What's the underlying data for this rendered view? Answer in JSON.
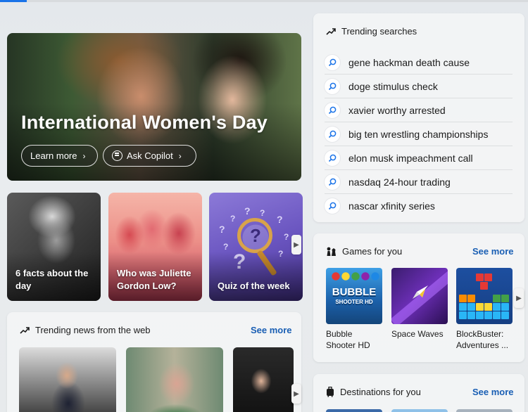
{
  "hero": {
    "title": "International Women's Day",
    "learn_more": "Learn more",
    "ask_copilot": "Ask Copilot"
  },
  "cards": [
    {
      "label": "6 facts about the day"
    },
    {
      "label": "Who was Juliette Gordon Low?"
    },
    {
      "label": "Quiz of the week"
    }
  ],
  "trending_news": {
    "title": "Trending news from the web",
    "see_more": "See more"
  },
  "trending_searches": {
    "title": "Trending searches",
    "items": [
      "gene hackman death cause",
      "doge stimulus check",
      "xavier worthy arrested",
      "big ten wrestling championships",
      "elon musk impeachment call",
      "nasdaq 24-hour trading",
      "nascar xfinity series"
    ]
  },
  "games": {
    "title": "Games for you",
    "see_more": "See more",
    "items": [
      {
        "name": "Bubble Shooter HD",
        "logo_line1": "BUBBLE",
        "logo_line2": "SHOOTER HD"
      },
      {
        "name": "Space Waves"
      },
      {
        "name": "BlockBuster: Adventures ..."
      }
    ]
  },
  "destinations": {
    "title": "Destinations for you",
    "see_more": "See more"
  },
  "colors": {
    "accent": "#1a73e8",
    "link": "#1a5fb4"
  }
}
